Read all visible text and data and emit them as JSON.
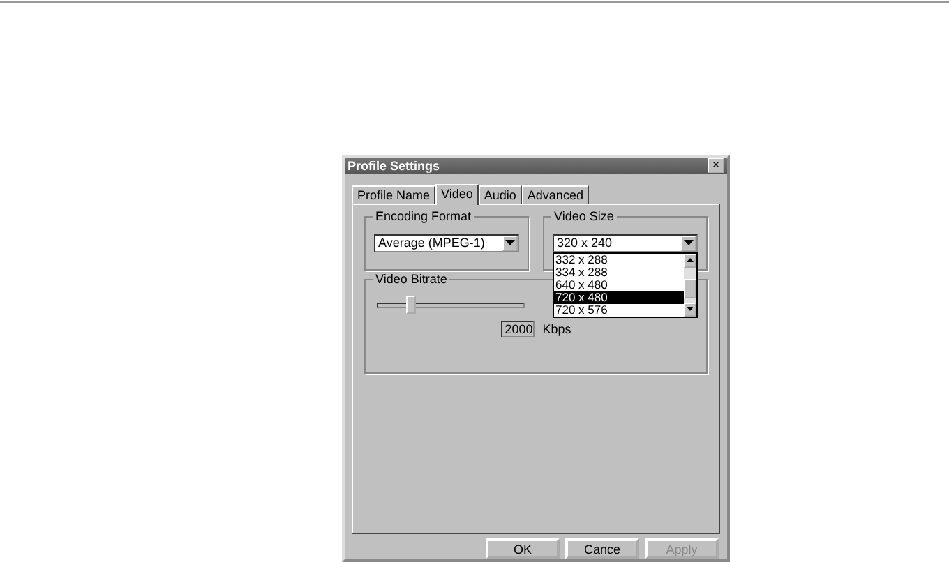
{
  "window": {
    "title": "Profile Settings",
    "close": "×"
  },
  "tabs": [
    {
      "label": "Profile Name",
      "selected": false
    },
    {
      "label": "Video",
      "selected": true
    },
    {
      "label": "Audio",
      "selected": false
    },
    {
      "label": "Advanced",
      "selected": false
    }
  ],
  "encoding_format": {
    "label": "Encoding Format",
    "value": "Average (MPEG-1)"
  },
  "video_size": {
    "label": "Video Size",
    "value": "320 x 240",
    "expanded": true,
    "options": [
      {
        "label": "332 x 288",
        "selected": false
      },
      {
        "label": "334 x 288",
        "selected": false
      },
      {
        "label": "640 x 480",
        "selected": false
      },
      {
        "label": "720 x 480",
        "selected": true
      },
      {
        "label": "720 x 576",
        "selected": false
      }
    ]
  },
  "video_bitrate": {
    "label": "Video Bitrate",
    "level": 0.19,
    "value": "2000",
    "unit": "Kbps"
  },
  "buttons": [
    {
      "label": "OK",
      "disabled": false
    },
    {
      "label": "Cance",
      "disabled": false
    },
    {
      "label": "Apply",
      "disabled": true
    }
  ]
}
